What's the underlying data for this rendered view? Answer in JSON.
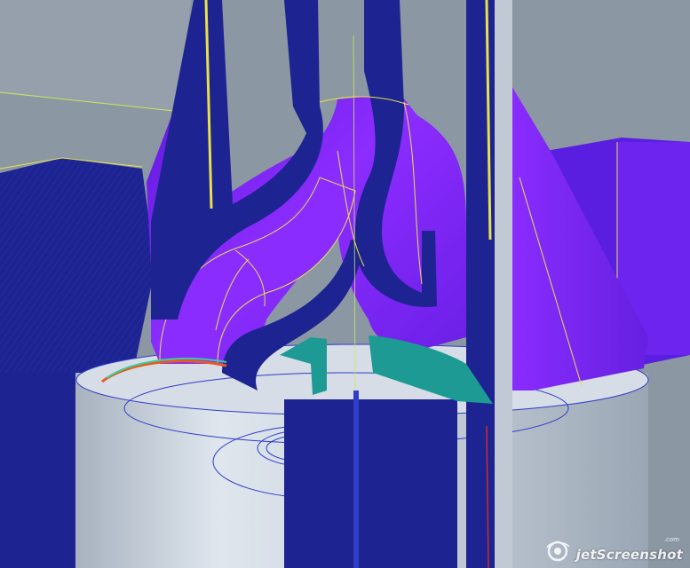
{
  "scene": {
    "kind": "cad-3d-model-view",
    "colors": {
      "background": "#8b97a3",
      "floor": "#6f7b88",
      "violet": "#7a22f0",
      "violet_light": "#9b3cff",
      "navy": "#1d2391",
      "navy_dark": "#0f1466",
      "teal": "#1d9a94",
      "cylinder": "#c9d2dc",
      "edge_yellow": "#e8e24a",
      "edge_blue": "#2f3cc8"
    }
  },
  "watermark": {
    "brand": "jetScreenshot",
    "suffix": ".com",
    "icon": "camera-swirl-icon"
  }
}
